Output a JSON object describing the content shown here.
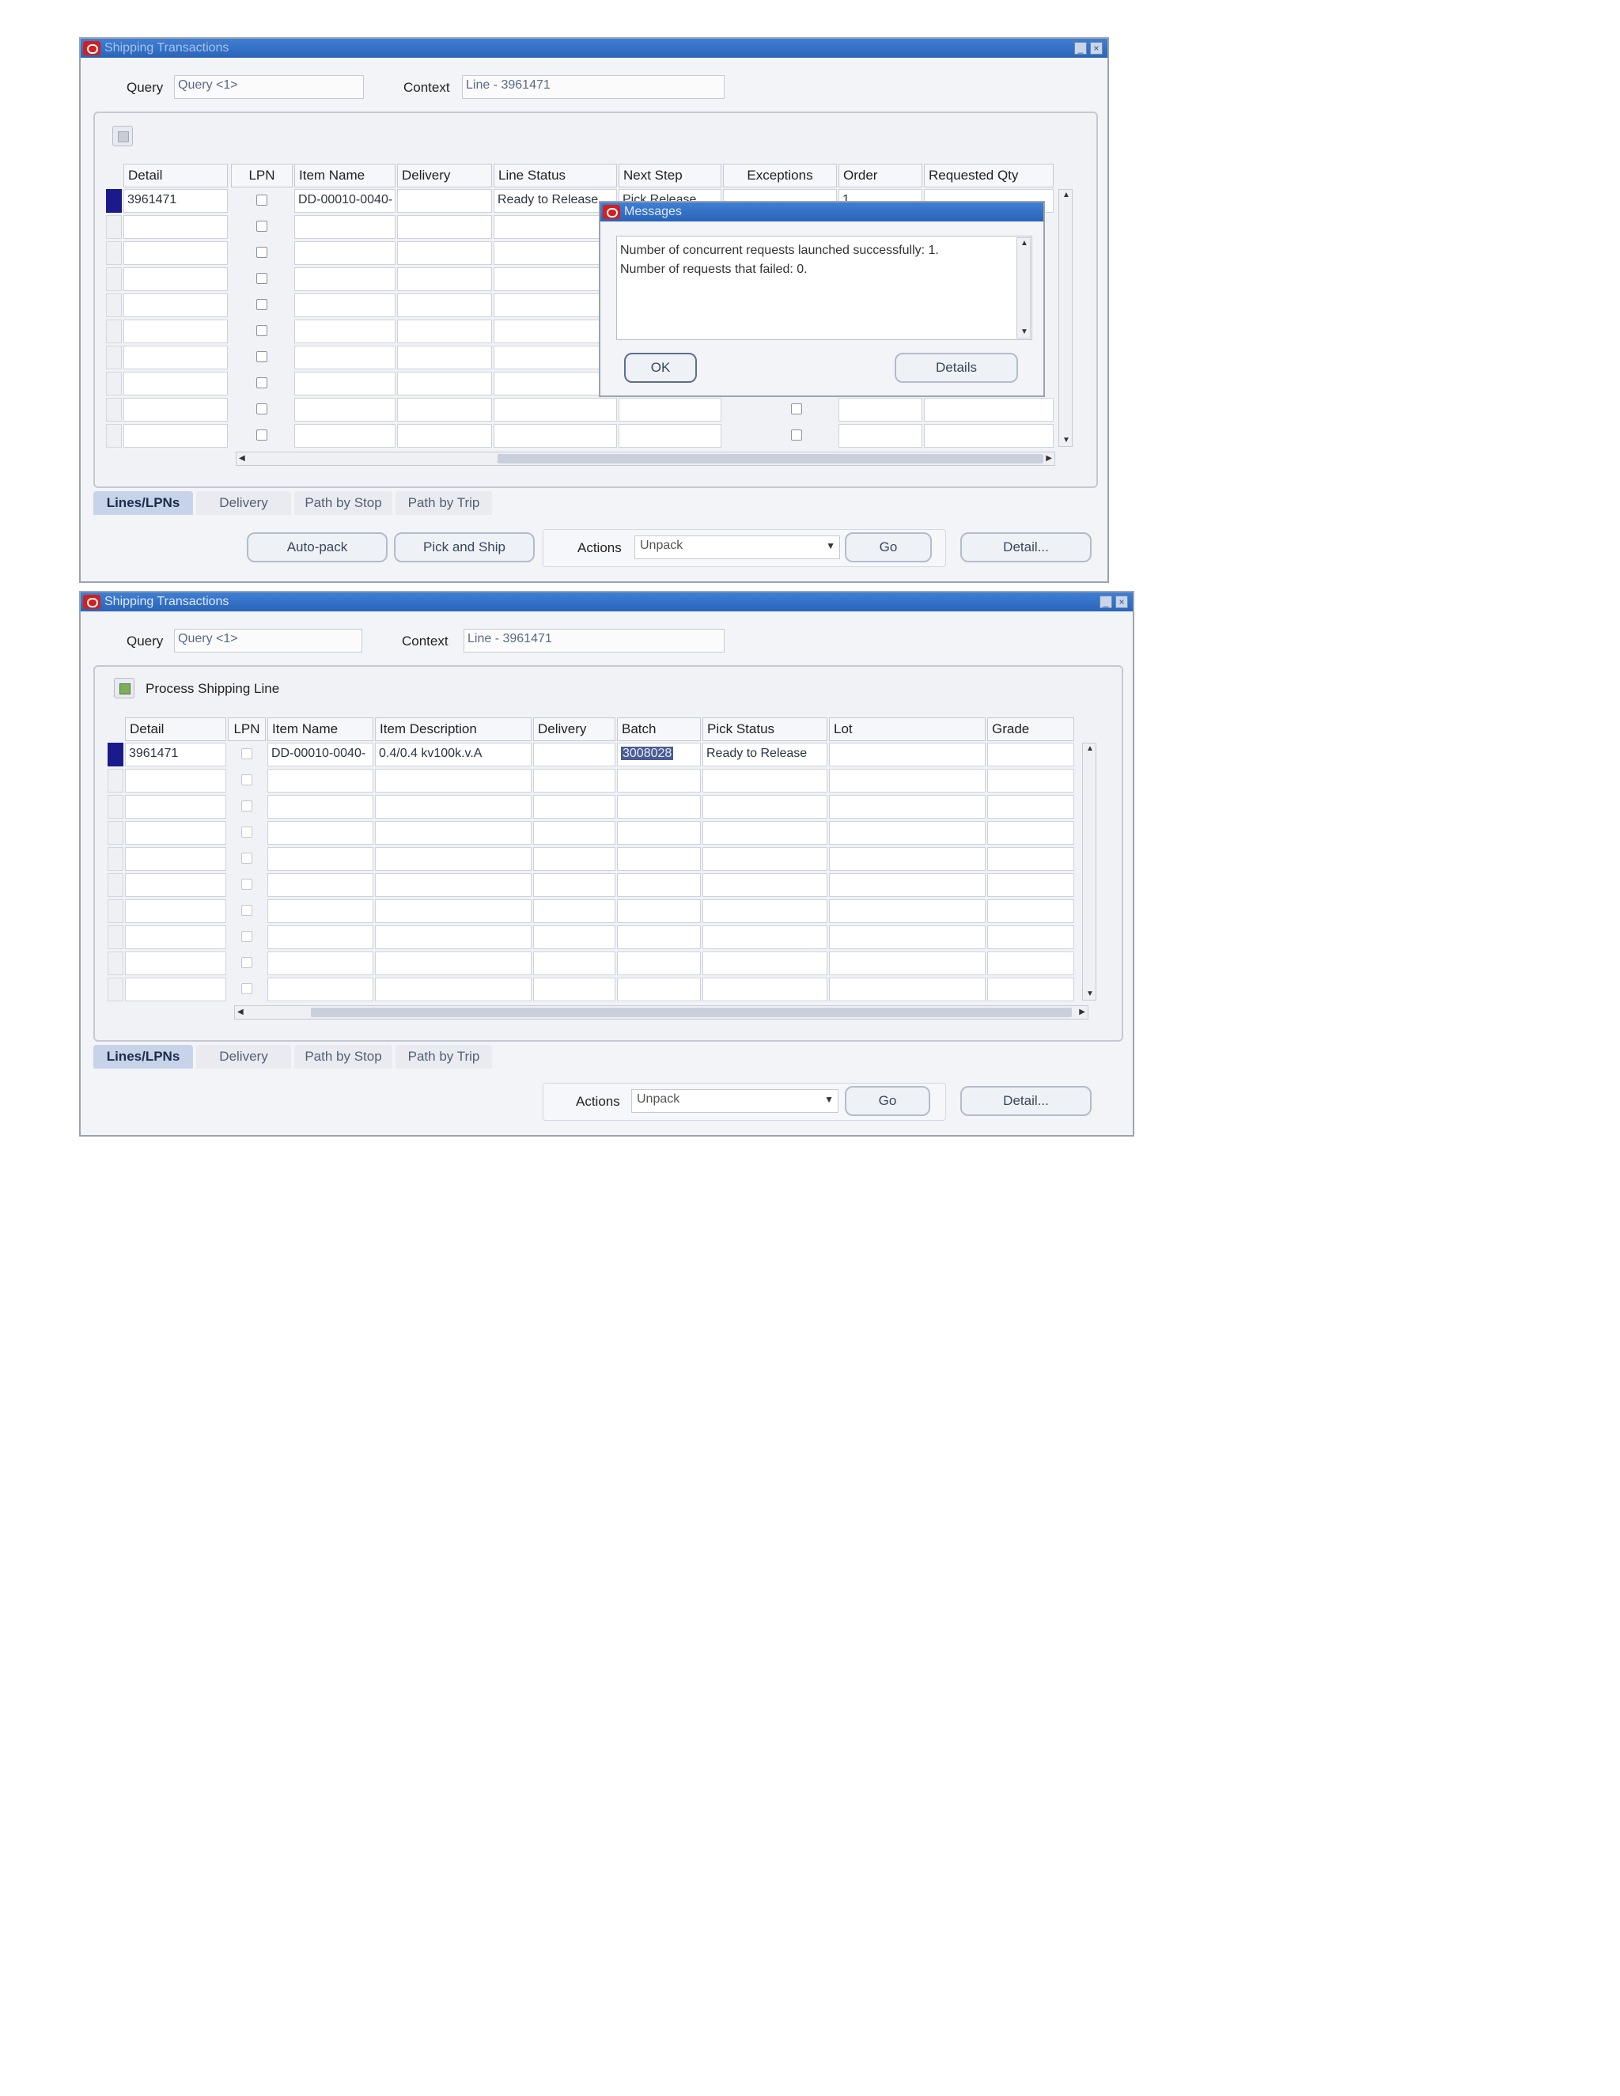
{
  "window1": {
    "title": "Shipping Transactions",
    "query_label": "Query",
    "query_value": "Query <1>",
    "context_label": "Context",
    "context_value": "Line - 3961471",
    "columns": [
      "Detail",
      "LPN",
      "Item Name",
      "Delivery",
      "Line Status",
      "Next Step",
      "Exceptions",
      "Order",
      "Requested Qty"
    ],
    "row1": {
      "detail": "3961471",
      "item_name": "DD-00010-0040-",
      "line_status": "Ready to Release",
      "next_step": "Pick Release",
      "order": "1"
    },
    "tabs": [
      "Lines/LPNs",
      "Delivery",
      "Path by Stop",
      "Path by Trip"
    ],
    "buttons": {
      "autopack": "Auto-pack",
      "pick_ship": "Pick and Ship",
      "actions_label": "Actions",
      "actions_value": "Unpack",
      "go": "Go",
      "detail": "Detail..."
    }
  },
  "messages_dialog": {
    "title": "Messages",
    "line1": "Number of concurrent requests launched successfully: 1.",
    "line2": "Number of requests that failed: 0.",
    "ok": "OK",
    "details": "Details"
  },
  "window2": {
    "title": "Shipping Transactions",
    "query_label": "Query",
    "query_value": "Query <1>",
    "context_label": "Context",
    "context_value": "Line - 3961471",
    "process_label": "Process Shipping Line",
    "columns": [
      "Detail",
      "LPN",
      "Item Name",
      "Item Description",
      "Delivery",
      "Batch",
      "Pick Status",
      "Lot",
      "Grade"
    ],
    "row1": {
      "detail": "3961471",
      "item_name": "DD-00010-0040-",
      "item_description": "0.4/0.4 kv100k.v.A",
      "batch": "3008028",
      "pick_status": "Ready to Release"
    },
    "tabs": [
      "Lines/LPNs",
      "Delivery",
      "Path by Stop",
      "Path by Trip"
    ],
    "buttons": {
      "actions_label": "Actions",
      "actions_value": "Unpack",
      "go": "Go",
      "detail": "Detail..."
    }
  },
  "colors": {
    "titlebar": "#2f6cc0",
    "selected_row_marker": "#1a1a8c",
    "oracle_red": "#d21f1f"
  }
}
